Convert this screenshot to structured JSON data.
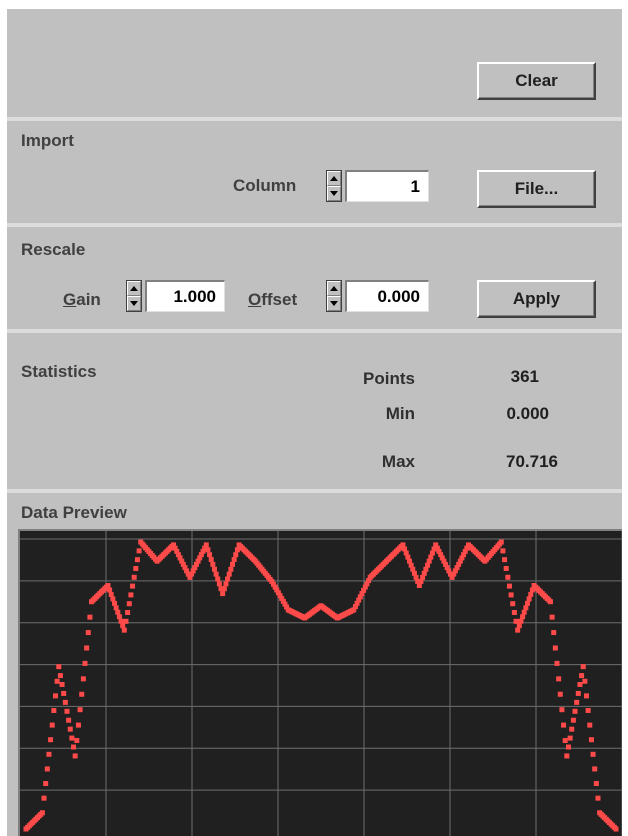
{
  "toolbar": {
    "clear_label": "Clear"
  },
  "import": {
    "section_title": "Import",
    "column_label": "Column",
    "column_value": "1",
    "file_label": "File..."
  },
  "rescale": {
    "section_title": "Rescale",
    "gain_label": "Gain",
    "gain_value": "1.000",
    "offset_label": "Offset",
    "offset_value": "0.000",
    "apply_label": "Apply"
  },
  "statistics": {
    "section_title": "Statistics",
    "points_label": "Points",
    "points_value": "361",
    "min_label": "Min",
    "min_value": "0.000",
    "max_label": "Max",
    "max_value": "70.716"
  },
  "preview": {
    "section_title": "Data Preview",
    "series_color": "#ff4a4a",
    "grid_color": "#6e6e6e"
  },
  "chart_data": {
    "type": "scatter",
    "title": "",
    "xlabel": "",
    "ylabel": "",
    "grid": true,
    "x": [
      0,
      10,
      20,
      30,
      40,
      50,
      60,
      70,
      80,
      90,
      100,
      110,
      120,
      130,
      140,
      150,
      160,
      170,
      180,
      190,
      200,
      210,
      220,
      230,
      240,
      250,
      260,
      270,
      280,
      290,
      300,
      310,
      320,
      330,
      340,
      350,
      360
    ],
    "values": [
      0.0,
      4.0,
      40.0,
      18.0,
      56.0,
      60.0,
      49.0,
      70.7,
      66.0,
      70.0,
      62.0,
      70.0,
      58.0,
      70.0,
      66.0,
      61.0,
      54.0,
      52.0,
      55.0,
      52.0,
      54.0,
      62.0,
      66.0,
      70.0,
      60.0,
      70.0,
      62.0,
      70.0,
      66.0,
      70.7,
      49.0,
      60.0,
      56.0,
      18.0,
      40.0,
      4.0,
      0.0
    ],
    "xlim": [
      0,
      360
    ],
    "ylim": [
      0,
      70.716
    ]
  }
}
